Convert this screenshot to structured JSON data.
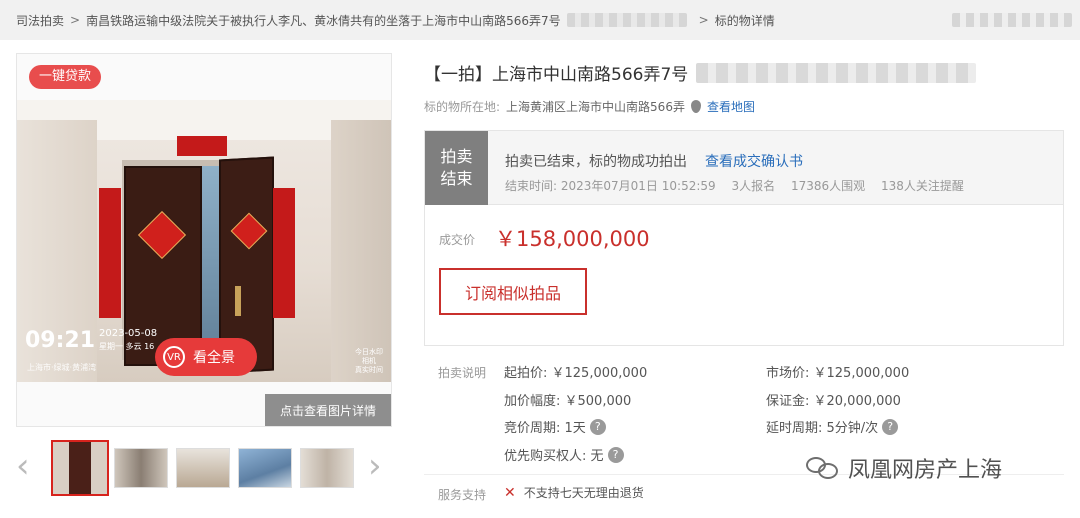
{
  "breadcrumb": {
    "items": [
      "司法拍卖",
      "南昌铁路运输中级法院关于被执行人李凡、黄冰倩共有的坐落于上海市中山南路566弄7号",
      "标的物详情"
    ],
    "separator": ">"
  },
  "gallery": {
    "loan_badge": "一键贷款",
    "overlay_time": "09:21",
    "overlay_date": "2023-05-08",
    "overlay_weekday": "星期一 多云 16",
    "overlay_location": "上海市·绿城·黄浦湾",
    "panorama_label": "看全景",
    "detail_button": "点击查看图片详情",
    "thumbnail_count": 5,
    "selected_thumbnail": 0
  },
  "item": {
    "title": "【一拍】上海市中山南路566弄7号",
    "address_label": "标的物所在地:",
    "address_value": "上海黄浦区上海市中山南路566弄",
    "map_link": "查看地图"
  },
  "status": {
    "tag_line1": "拍卖",
    "tag_line2": "结束",
    "message": "拍卖已结束，标的物成功拍出",
    "confirm_link": "查看成交确认书",
    "end_time": "结束时间: 2023年07月01日 10:52:59",
    "registrations": "3人报名",
    "views": "17386人围观",
    "watchers": "138人关注提醒",
    "deal_label": "成交价",
    "deal_price": "￥158,000,000",
    "subscribe_button": "订阅相似拍品"
  },
  "auction_info": {
    "section_label": "拍卖说明",
    "start_price": "起拍价: ￥125,000,000",
    "market_price": "市场价: ￥125,000,000",
    "increment": "加价幅度: ￥500,000",
    "deposit": "保证金: ￥20,000,000",
    "bid_period": "竞价周期: 1天",
    "extension": "延时周期: 5分钟/次",
    "priority": "优先购买权人: 无",
    "service_label": "服务支持",
    "service_value": "不支持七天无理由退货"
  },
  "watermark": {
    "text": "凤凰网房产上海"
  },
  "colors": {
    "accent_red": "#c9302c",
    "link_blue": "#2a6ebb",
    "status_tag_gray": "#7f7f7f"
  }
}
